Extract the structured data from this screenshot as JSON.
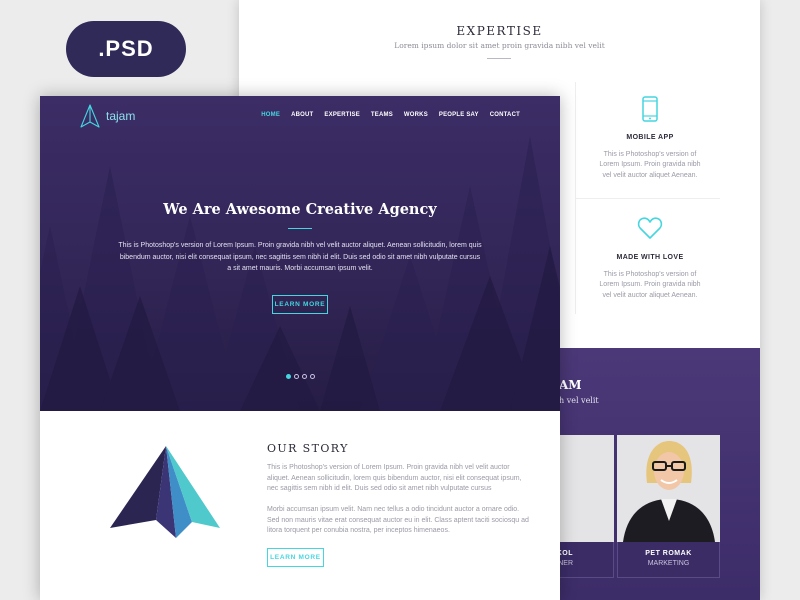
{
  "badge": {
    "label": ".PSD"
  },
  "expertise": {
    "title": "EXPERTISE",
    "subtitle": "Lorem ipsum dolor sit amet proin gravida nibh vel velit",
    "services": [
      {
        "icon": "mobile-icon",
        "title": "MOBILE APP",
        "text": "This is Photoshop's version  of Lorem Ipsum. Proin gravida nibh vel velit auctor aliquet Aenean."
      },
      {
        "icon": "heart-icon",
        "title": "MADE WITH LOVE",
        "text": "This is Photoshop's version  of Lorem Ipsum. Proin gravida nibh vel velit auctor aliquet Aenean."
      }
    ]
  },
  "team": {
    "title_partial": "AM",
    "subtitle_partial": "h vel velit",
    "members": [
      {
        "name": "KOL",
        "role": "NER"
      },
      {
        "name": "PET ROMAK",
        "role": "MARKETING"
      }
    ]
  },
  "brand": {
    "name": "tajam",
    "accent": "#45d6e0",
    "primary": "#2f2a57"
  },
  "nav": {
    "items": [
      "HOME",
      "ABOUT",
      "EXPERTISE",
      "TEAMS",
      "WORKS",
      "PEOPLE SAY",
      "CONTACT"
    ],
    "active": "HOME"
  },
  "hero": {
    "title": "We Are Awesome Creative Agency",
    "text": "This is Photoshop's version  of Lorem Ipsum. Proin gravida nibh vel velit auctor aliquet. Aenean sollicitudin, lorem quis bibendum auctor, nisi elit consequat ipsum, nec sagittis sem nibh id elit. Duis sed odio sit amet nibh vulputate cursus a sit amet mauris. Morbi accumsan ipsum velit.",
    "button": "LEARN MORE",
    "slides": 4,
    "active_slide": 1
  },
  "story": {
    "title": "OUR STORY",
    "paragraph1": "This is Photoshop's version  of Lorem Ipsum. Proin gravida nibh vel velit auctor aliquet. Aenean sollicitudin, lorem quis bibendum auctor, nisi elit consequat ipsum, nec sagittis sem nibh id elit. Duis sed odio sit amet nibh vulputate cursus",
    "paragraph2": "Morbi accumsan ipsum velit. Nam nec tellus a odio tincidunt auctor a ornare odio. Sed non  mauris vitae erat consequat auctor eu in elit. Class aptent taciti sociosqu ad litora torquent per conubia nostra, per inceptos himenaeos.",
    "button": "LEARN MORE"
  }
}
